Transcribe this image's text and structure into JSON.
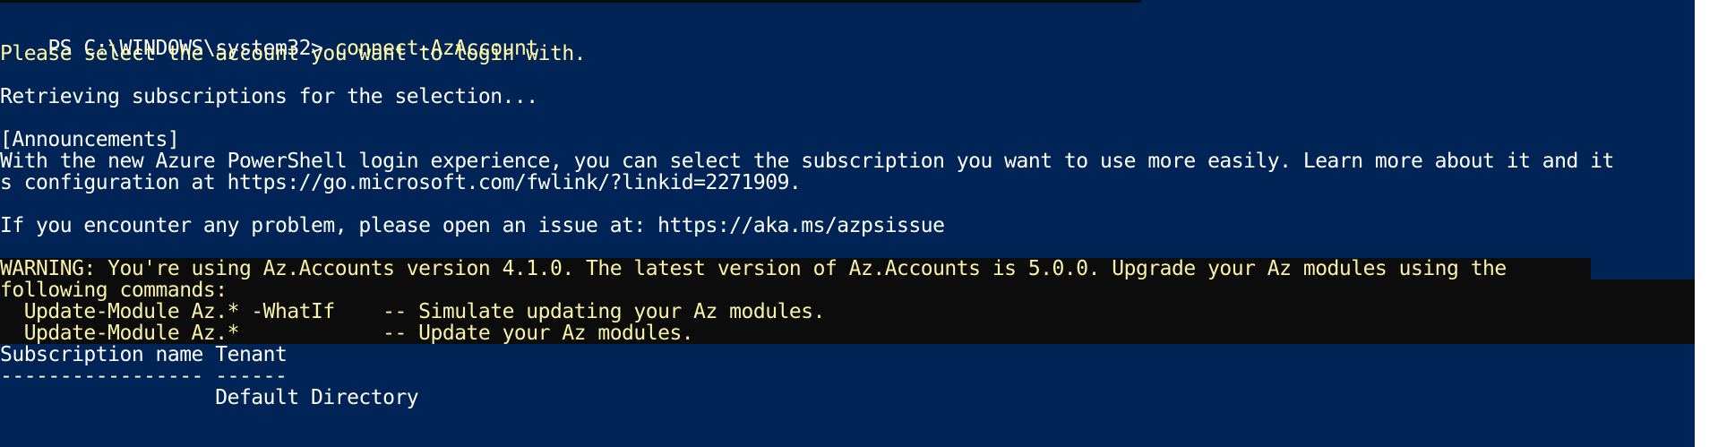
{
  "colors": {
    "background": "#012456",
    "default_text": "#ffffff",
    "command_text": "#fff9a8",
    "warning_background": "#0c0c0c",
    "warning_text": "#f9f1a5"
  },
  "terminal": {
    "prompt": "PS C:\\WINDOWS\\system32> ",
    "command": "connect-AzAccount",
    "lines": [
      "Please select the account you want to login with.",
      "Retrieving subscriptions for the selection...",
      "[Announcements]",
      "With the new Azure PowerShell login experience, you can select the subscription you want to use more easily. Learn more about it and it",
      "s configuration at https://go.microsoft.com/fwlink/?linkid=2271909.",
      "If you encounter any problem, please open an issue at: https://aka.ms/azpsissue"
    ],
    "warning": [
      "WARNING: You're using Az.Accounts version 4.1.0. The latest version of Az.Accounts is 5.0.0. Upgrade your Az modules using the ",
      "following commands:",
      "  Update-Module Az.* -WhatIf    -- Simulate updating your Az modules.",
      "  Update-Module Az.*            -- Update your Az modules."
    ],
    "table": {
      "header": "Subscription name Tenant",
      "separator": "----------------- ------",
      "row": "                  Default Directory"
    }
  }
}
